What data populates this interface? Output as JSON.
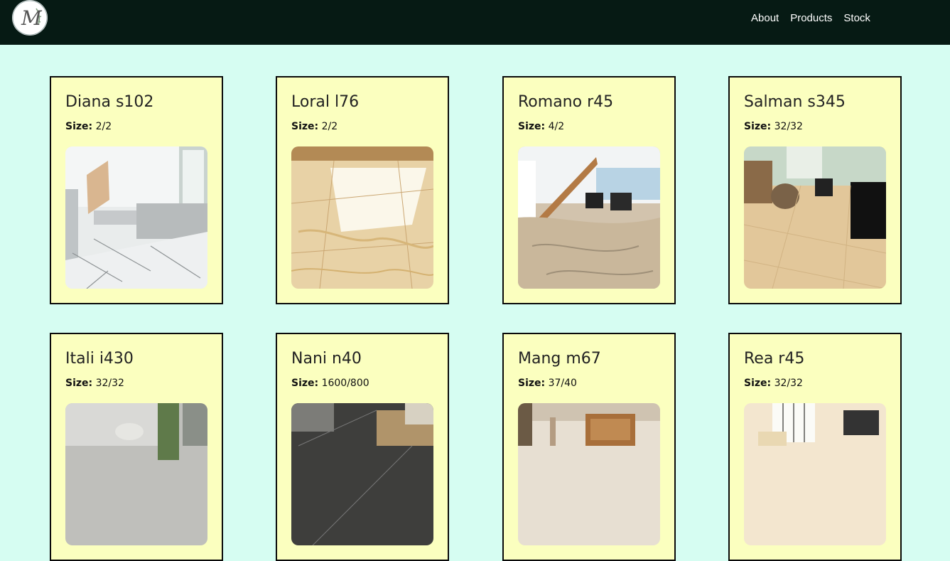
{
  "nav": {
    "logo_letter": "M",
    "links": [
      "About",
      "Products",
      "Stock"
    ]
  },
  "products": [
    {
      "name": "Diana s102",
      "size_label": "Size:",
      "size": "2/2",
      "image": "white-marble-living-room-photo"
    },
    {
      "name": "Loral l76",
      "size_label": "Size:",
      "size": "2/2",
      "image": "golden-marble-floor-photo"
    },
    {
      "name": "Romano r45",
      "size_label": "Size:",
      "size": "4/2",
      "image": "beige-marble-staircase-room-photo"
    },
    {
      "name": "Salman s345",
      "size_label": "Size:",
      "size": "32/32",
      "image": "beige-tile-lounge-photo"
    },
    {
      "name": "Itali i430",
      "size_label": "Size:",
      "size": "32/32",
      "image": "grey-tile-interior-photo"
    },
    {
      "name": "Nani n40",
      "size_label": "Size:",
      "size": "1600/800",
      "image": "black-marble-floor-photo"
    },
    {
      "name": "Mang m67",
      "size_label": "Size:",
      "size": "37/40",
      "image": "wood-cabinet-room-photo"
    },
    {
      "name": "Rea r45",
      "size_label": "Size:",
      "size": "32/32",
      "image": "cream-tile-living-room-photo"
    }
  ],
  "colors": {
    "navbar": "#061a14",
    "page_background": "#d6fdf2",
    "card_background": "#fbffbf",
    "card_border": "#0a0a0a"
  }
}
